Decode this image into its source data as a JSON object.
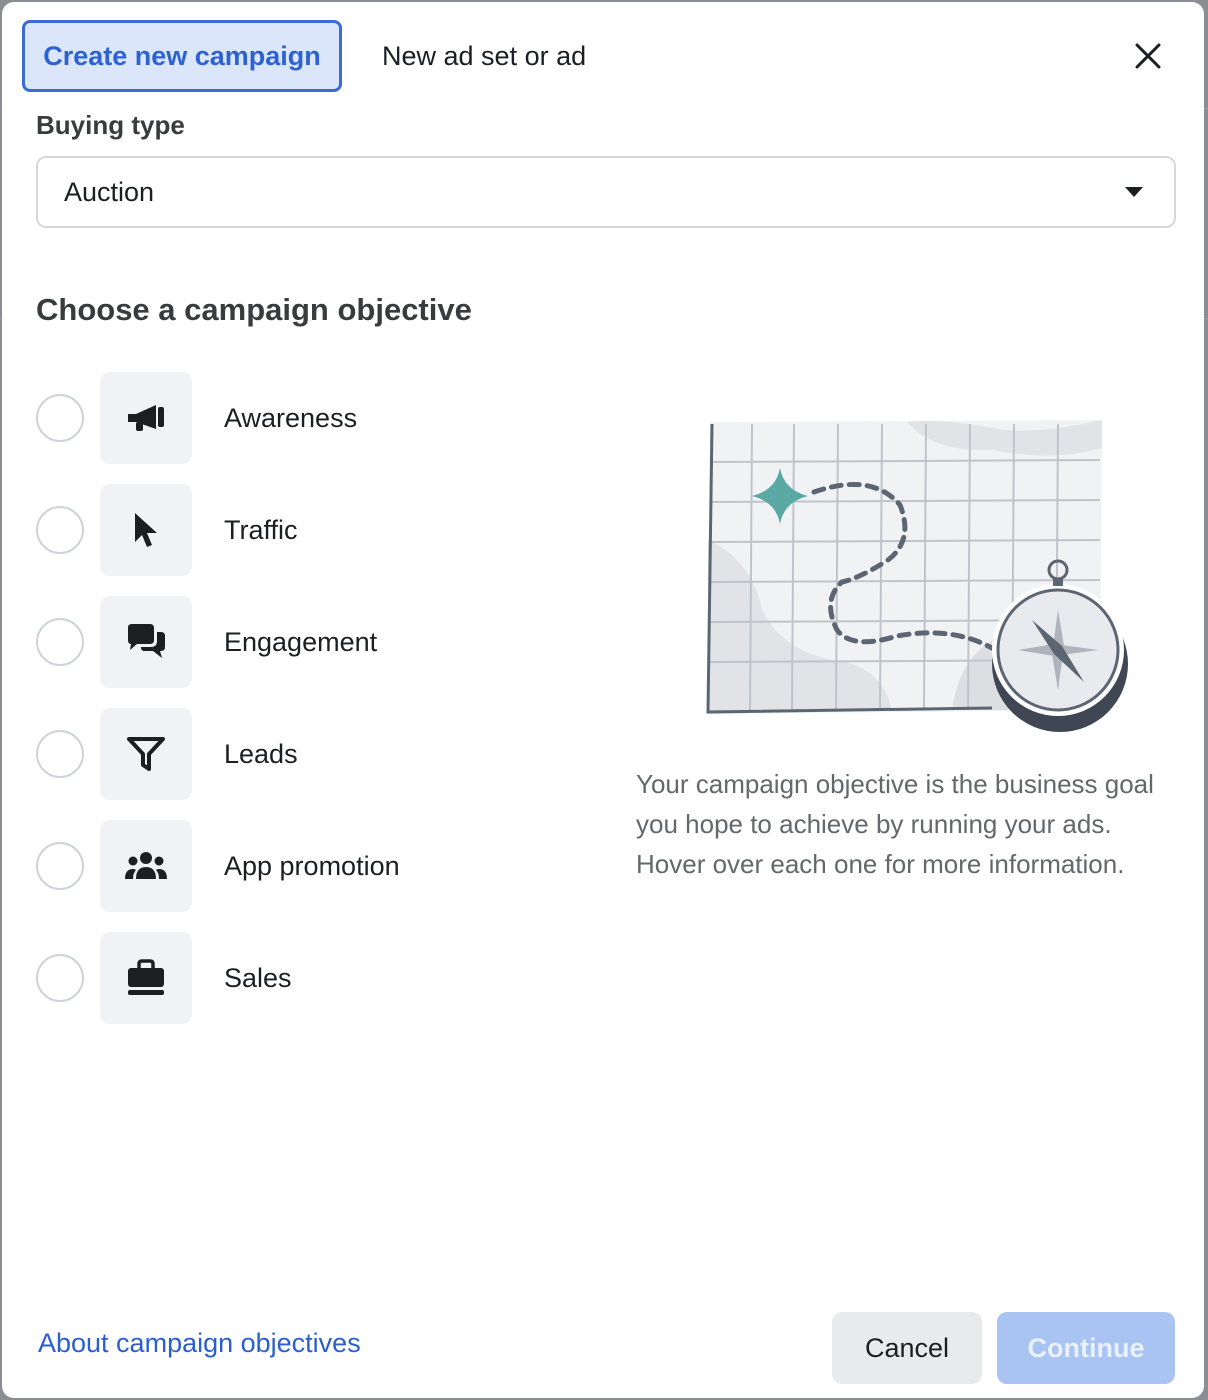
{
  "tabs": {
    "create_campaign": "Create new campaign",
    "new_adset_or_ad": "New ad set or ad"
  },
  "buying_type": {
    "label": "Buying type",
    "selected": "Auction"
  },
  "objective_section": {
    "heading": "Choose a campaign objective",
    "objectives": [
      {
        "label": "Awareness",
        "icon": "megaphone-icon",
        "selected": false
      },
      {
        "label": "Traffic",
        "icon": "cursor-icon",
        "selected": false
      },
      {
        "label": "Engagement",
        "icon": "chat-bubbles-icon",
        "selected": false
      },
      {
        "label": "Leads",
        "icon": "funnel-icon",
        "selected": false
      },
      {
        "label": "App promotion",
        "icon": "people-group-icon",
        "selected": false
      },
      {
        "label": "Sales",
        "icon": "shopping-bag-icon",
        "selected": false
      }
    ],
    "description": "Your campaign objective is the business goal you hope to achieve by running your ads. Hover over each one for more information."
  },
  "footer": {
    "about_link": "About campaign objectives",
    "cancel_label": "Cancel",
    "continue_label": "Continue"
  },
  "colors": {
    "accent": "#2d62d3",
    "accent_light": "#dbe6fb",
    "continue_disabled": "#a9c3f2",
    "illustration_teal": "#5aa9a4"
  }
}
